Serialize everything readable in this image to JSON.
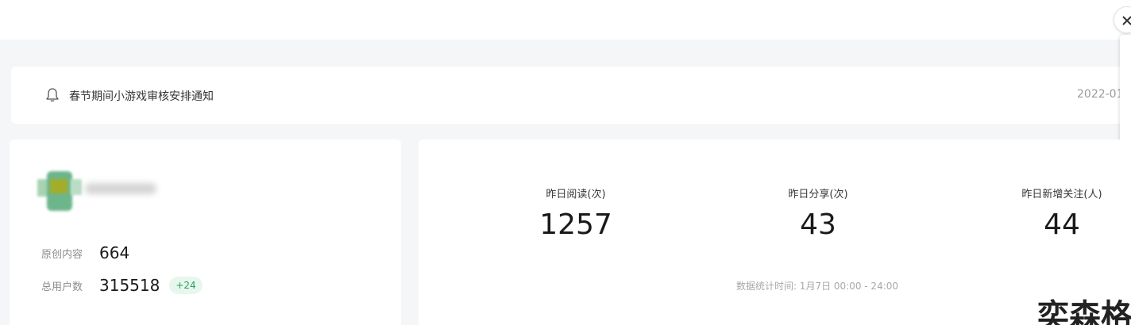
{
  "notice": {
    "title": "春节期间小游戏审核安排通知",
    "date": "2022-01"
  },
  "account": {
    "stats": [
      {
        "label": "原创内容",
        "value": "664"
      },
      {
        "label": "总用户数",
        "value": "315518",
        "badge": "+24"
      }
    ]
  },
  "metrics": [
    {
      "label": "昨日阅读(次)",
      "value": "1257"
    },
    {
      "label": "昨日分享(次)",
      "value": "43"
    },
    {
      "label": "昨日新增关注(人)",
      "value": "44"
    }
  ],
  "stats_note": "数据统计时间: 1月7日 00:00 - 24:00",
  "watermark": "奕森格",
  "colors": {
    "page_bg": "#f5f6f7",
    "card_bg": "#ffffff",
    "badge_text": "#25a25a",
    "badge_bg": "#e8f7ee"
  }
}
